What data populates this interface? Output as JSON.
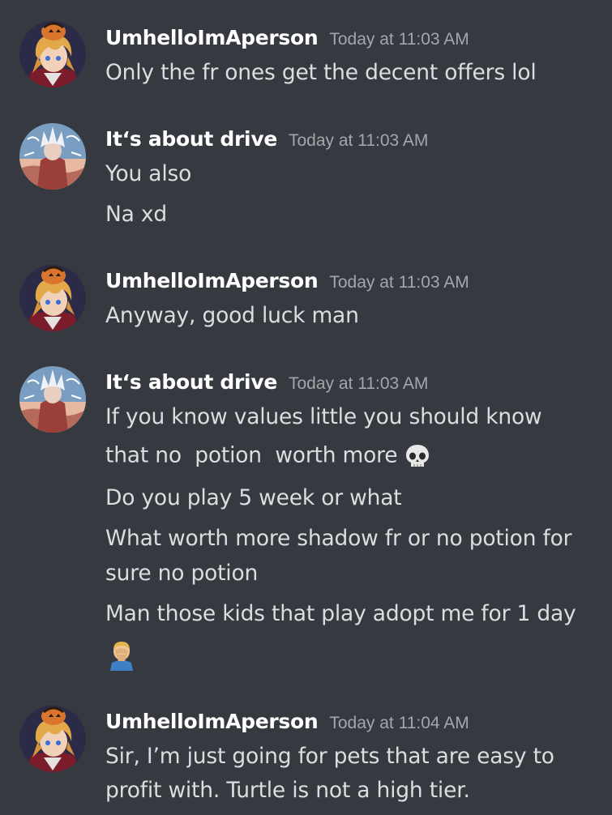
{
  "messages": [
    {
      "author": "UmhelloImAperson",
      "timestamp": "Today at 11:03 AM",
      "avatar_icon": "anime-avatar-pumpkin-hat",
      "lines": [
        "Only the fr ones get the decent offers lol"
      ]
    },
    {
      "author": "It‘s about drive",
      "timestamp": "Today at 11:03 AM",
      "avatar_icon": "anime-avatar-goku",
      "lines": [
        "You also",
        "Na xd"
      ]
    },
    {
      "author": "UmhelloImAperson",
      "timestamp": "Today at 11:03 AM",
      "avatar_icon": "anime-avatar-pumpkin-hat",
      "lines": [
        "Anyway, good luck man"
      ]
    },
    {
      "author": "It‘s about drive",
      "timestamp": "Today at 11:03 AM",
      "avatar_icon": "anime-avatar-goku",
      "lines": [
        "If you know values little you should know",
        "that no  potion  worth more",
        "Do you play 5 week or what",
        "What worth more shadow fr or no potion for",
        "sure no potion",
        "Man those kids that play adopt me for 1 day"
      ],
      "emojis": [
        "skull-emoji",
        "facepalm-emoji"
      ]
    },
    {
      "author": "UmhelloImAperson",
      "timestamp": "Today at 11:04 AM",
      "avatar_icon": "anime-avatar-pumpkin-hat",
      "lines": [
        "Sir, I’m just going for pets that are easy to",
        "profit with. Turtle is not a high tier."
      ]
    }
  ],
  "colors": {
    "background": "#36393f",
    "username": "#ffffff",
    "timestamp": "#a3a6aa",
    "message_text": "#dcddde"
  }
}
